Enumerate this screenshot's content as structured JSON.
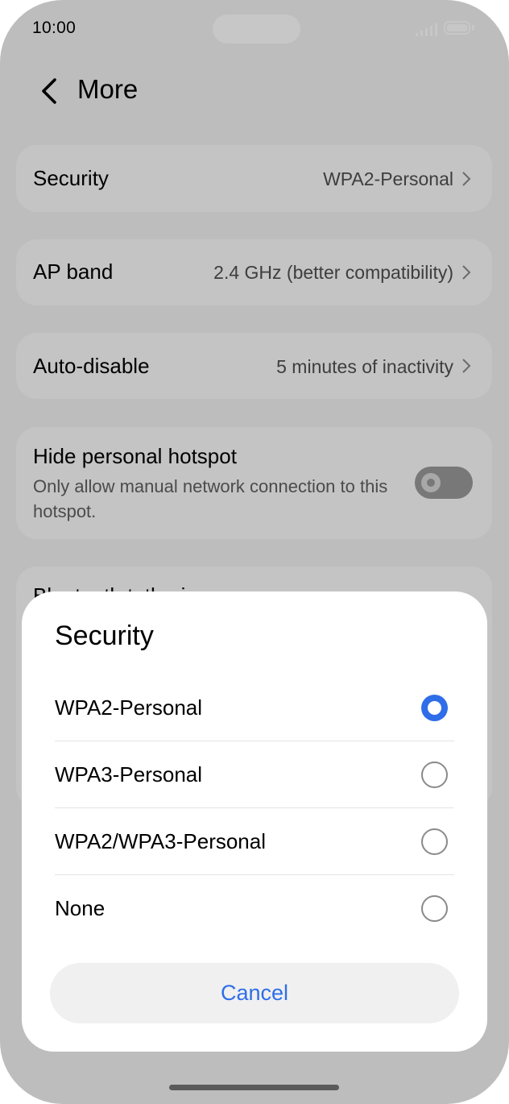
{
  "status_bar": {
    "time": "10:00"
  },
  "header": {
    "title": "More"
  },
  "settings": [
    {
      "label": "Security",
      "value": "WPA2-Personal"
    },
    {
      "label": "AP band",
      "value": "2.4 GHz (better compatibility)"
    },
    {
      "label": "Auto-disable",
      "value": "5 minutes of inactivity"
    }
  ],
  "hide_hotspot": {
    "label": "Hide personal hotspot",
    "description": "Only allow manual network connection to this hotspot.",
    "enabled": false
  },
  "partial_card": {
    "label": "Bluetooth tethering"
  },
  "dialog": {
    "title": "Security",
    "options": [
      {
        "label": "WPA2-Personal",
        "selected": true
      },
      {
        "label": "WPA3-Personal",
        "selected": false
      },
      {
        "label": "WPA2/WPA3-Personal",
        "selected": false
      },
      {
        "label": "None",
        "selected": false
      }
    ],
    "cancel_label": "Cancel"
  },
  "colors": {
    "accent": "#2f6ee8",
    "background": "#f2f2f4"
  }
}
